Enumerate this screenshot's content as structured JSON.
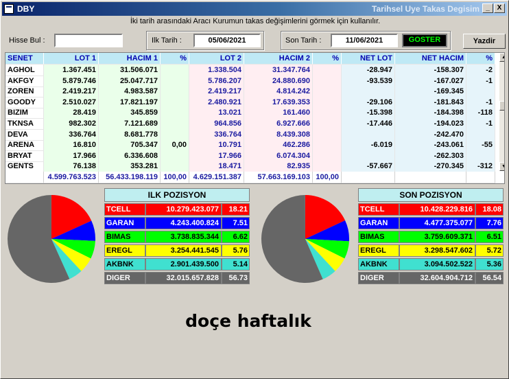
{
  "window": {
    "title_left": "DBY",
    "title_right": "Tarihsel Uye Takas Degisim",
    "minimize_glyph": "_",
    "close_glyph": "X"
  },
  "info_text": "İki tarih arasındaki  Aracı Kurumun takas değişimlerini görmek için kullanılır.",
  "toolbar": {
    "hisse_label": "Hisse Bul :",
    "hisse_value": "",
    "ilk_label": "Ilk Tarih :",
    "ilk_value": "05/06/2021",
    "son_label": "Son Tarih :",
    "son_value": "11/06/2021",
    "goster_label": "GOSTER",
    "yazdir_label": "Yazdir"
  },
  "grid": {
    "columns": [
      "SENET",
      "LOT 1",
      "HACIM 1",
      "%",
      "LOT 2",
      "HACIM 2",
      "%",
      "NET LOT",
      "NET HACIM",
      "%"
    ],
    "rows": [
      [
        "AGHOL",
        "1.367.451",
        "31.506.071",
        "",
        "1.338.504",
        "31.347.764",
        "",
        "-28.947",
        "-158.307",
        "-2"
      ],
      [
        "AKFGY",
        "5.879.746",
        "25.047.717",
        "",
        "5.786.207",
        "24.880.690",
        "",
        "-93.539",
        "-167.027",
        "-1"
      ],
      [
        "ZOREN",
        "2.419.217",
        "4.983.587",
        "",
        "2.419.217",
        "4.814.242",
        "",
        "",
        "-169.345",
        ""
      ],
      [
        "GOODY",
        "2.510.027",
        "17.821.197",
        "",
        "2.480.921",
        "17.639.353",
        "",
        "-29.106",
        "-181.843",
        "-1"
      ],
      [
        "BIZIM",
        "28.419",
        "345.859",
        "",
        "13.021",
        "161.460",
        "",
        "-15.398",
        "-184.398",
        "-118"
      ],
      [
        "TKNSA",
        "982.302",
        "7.121.689",
        "",
        "964.856",
        "6.927.666",
        "",
        "-17.446",
        "-194.023",
        "-1"
      ],
      [
        "DEVA",
        "336.764",
        "8.681.778",
        "",
        "336.764",
        "8.439.308",
        "",
        "",
        "-242.470",
        ""
      ],
      [
        "ARENA",
        "16.810",
        "705.347",
        "0,00",
        "10.791",
        "462.286",
        "",
        "-6.019",
        "-243.061",
        "-55"
      ],
      [
        "BRYAT",
        "17.966",
        "6.336.608",
        "",
        "17.966",
        "6.074.304",
        "",
        "",
        "-262.303",
        ""
      ],
      [
        "GENTS",
        "76.138",
        "353.281",
        "",
        "18.471",
        "82.935",
        "",
        "-57.667",
        "-270.345",
        "-312"
      ]
    ],
    "totals": [
      "",
      "4.599.763.523",
      "56.433.198.119",
      "100,00",
      "4.629.151.387",
      "57.663.169.103",
      "100,00",
      "",
      "",
      ""
    ]
  },
  "ilk_pozisyon": {
    "title": "ILK POZISYON",
    "rows": [
      {
        "code": "TCELL",
        "value": "10.279.423.077",
        "pct": "18.21",
        "color": "#ff0000",
        "text": "#ffffff"
      },
      {
        "code": "GARAN",
        "value": "4.243.400.824",
        "pct": "7.51",
        "color": "#0000ff",
        "text": "#ffffff"
      },
      {
        "code": "BIMAS",
        "value": "3.738.835.344",
        "pct": "6.62",
        "color": "#00ff00",
        "text": "#000000"
      },
      {
        "code": "EREGL",
        "value": "3.254.441.545",
        "pct": "5.76",
        "color": "#ffff00",
        "text": "#000000"
      },
      {
        "code": "AKBNK",
        "value": "2.901.439.500",
        "pct": "5.14",
        "color": "#40e0d0",
        "text": "#000000"
      },
      {
        "code": "DIGER",
        "value": "32.015.657.828",
        "pct": "56.73",
        "color": "#666666",
        "text": "#ffffff"
      }
    ]
  },
  "son_pozisyon": {
    "title": "SON POZISYON",
    "rows": [
      {
        "code": "TCELL",
        "value": "10.428.229.816",
        "pct": "18.08",
        "color": "#ff0000",
        "text": "#ffffff"
      },
      {
        "code": "GARAN",
        "value": "4.477.375.077",
        "pct": "7.76",
        "color": "#0000ff",
        "text": "#ffffff"
      },
      {
        "code": "BIMAS",
        "value": "3.759.609.371",
        "pct": "6.51",
        "color": "#00ff00",
        "text": "#000000"
      },
      {
        "code": "EREGL",
        "value": "3.298.547.602",
        "pct": "5.72",
        "color": "#ffff00",
        "text": "#000000"
      },
      {
        "code": "AKBNK",
        "value": "3.094.502.522",
        "pct": "5.36",
        "color": "#40e0d0",
        "text": "#000000"
      },
      {
        "code": "DIGER",
        "value": "32.604.904.712",
        "pct": "56.54",
        "color": "#666666",
        "text": "#ffffff"
      }
    ]
  },
  "caption": "doçe haftalık"
}
